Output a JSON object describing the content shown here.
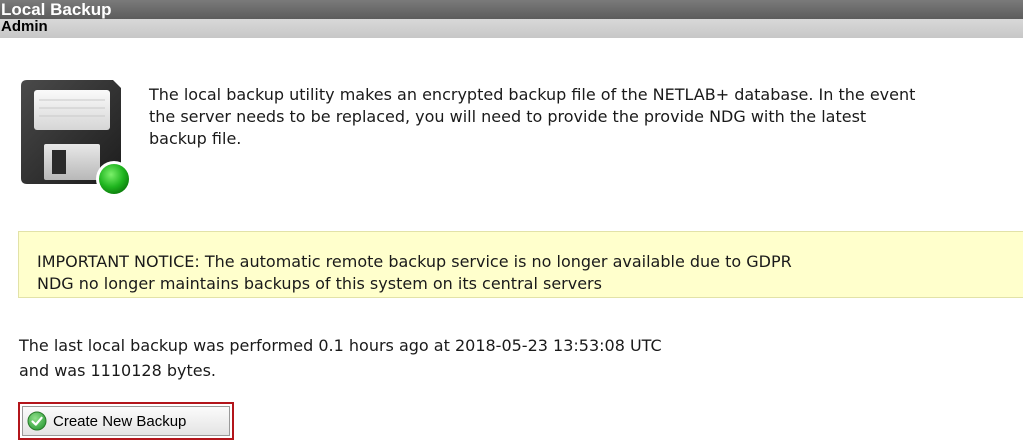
{
  "header": {
    "title": "Local Backup",
    "subtitle": "Admin"
  },
  "intro": {
    "icon": "floppy-disk-icon",
    "text": "The local backup utility makes an encrypted backup file of the NETLAB+ database. In the event the server needs to be replaced, you will need to provide the provide NDG with the latest backup file."
  },
  "notice": {
    "text_line1": "IMPORTANT NOTICE: The automatic remote backup service is no longer available due to GDPR",
    "text_line2": "NDG no longer maintains backups of this system on its central servers",
    "background_color": "#ffffcc"
  },
  "status": {
    "line1": "The last local backup was performed 0.1 hours ago at 2018-05-23 13:53:08 UTC",
    "line2": "and was 1110128 bytes."
  },
  "actions": {
    "create_backup_label": "Create New Backup",
    "create_backup_icon": "check-circle-icon",
    "focus_color": "#b3151b"
  }
}
